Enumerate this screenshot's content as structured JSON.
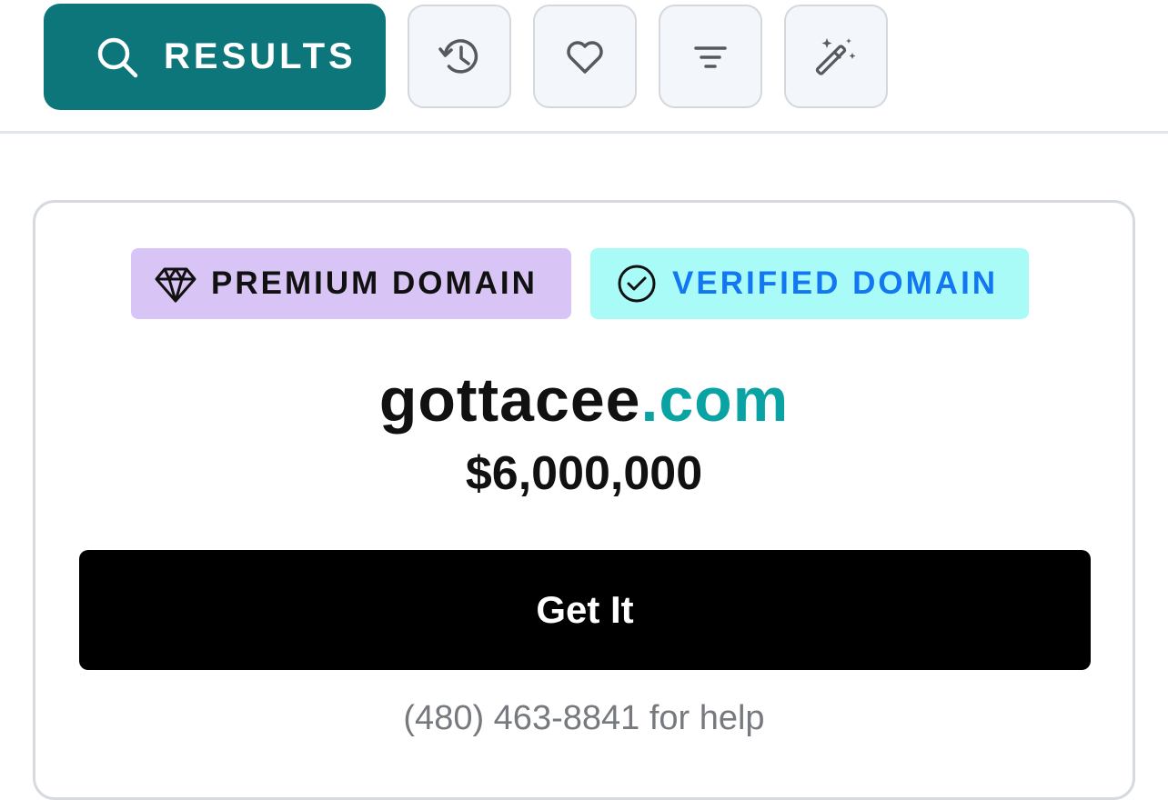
{
  "toolbar": {
    "results_label": "RESULTS",
    "results_icon": "search-icon",
    "tools": [
      {
        "name": "history",
        "icon": "history-icon"
      },
      {
        "name": "favorites",
        "icon": "heart-icon"
      },
      {
        "name": "filter",
        "icon": "filter-icon"
      },
      {
        "name": "magic",
        "icon": "magic-wand-icon"
      }
    ]
  },
  "card": {
    "badges": {
      "premium": {
        "label": "PREMIUM DOMAIN",
        "icon": "diamond-icon",
        "bg": "#d8c5f5",
        "color": "#111111"
      },
      "verified": {
        "label": "VERIFIED DOMAIN",
        "icon": "check-circle-icon",
        "bg": "#a9fbf7",
        "color": "#1277f0"
      }
    },
    "domain_name": "gottacee",
    "domain_tld": ".com",
    "price": "$6,000,000",
    "cta_label": "Get It",
    "help_text": "(480) 463-8841 for help"
  },
  "colors": {
    "accent": "#0c767a",
    "tld": "#0aa3a3",
    "cta": "#000000"
  }
}
